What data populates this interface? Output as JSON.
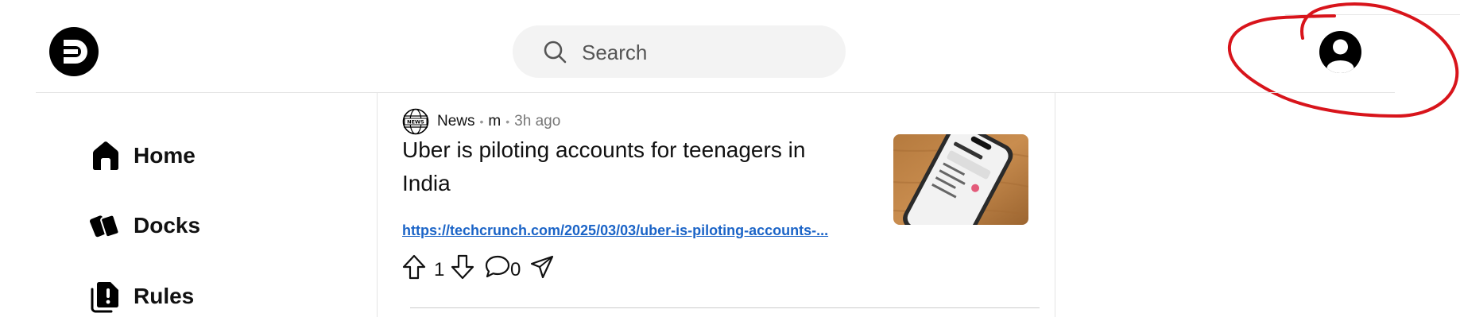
{
  "header": {
    "logo_icon": "dock-logo-icon",
    "search": {
      "placeholder": "Search",
      "value": ""
    },
    "profile_icon": "user-circle-icon"
  },
  "sidebar": {
    "items": [
      {
        "label": "Home",
        "icon": "home-icon"
      },
      {
        "label": "Docks",
        "icon": "docks-icon"
      },
      {
        "label": "Rules",
        "icon": "rules-icon"
      }
    ]
  },
  "post": {
    "community": "News",
    "author": "m",
    "time": "3h ago",
    "title": "Uber is piloting accounts for teenagers in India",
    "link": "https://techcrunch.com/2025/03/03/uber-is-piloting-accounts-...",
    "upvotes": "1",
    "comments": "0"
  },
  "colors": {
    "link": "#1b64c7",
    "annotation": "#d8141b",
    "search_bg": "#f3f3f3"
  }
}
